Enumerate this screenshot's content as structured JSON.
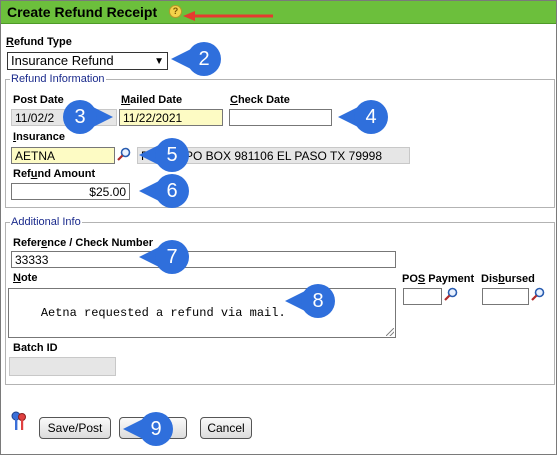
{
  "window": {
    "title": "Create Refund Receipt"
  },
  "refund_type": {
    "label": "Refund Type",
    "value": "Insurance Refund"
  },
  "refund_information": {
    "legend": "Refund Information",
    "post_date": {
      "label": "Post Date",
      "value": "11/02/2"
    },
    "mailed_date": {
      "label": "Mailed Date",
      "value": "11/22/2021"
    },
    "check_date": {
      "label": "Check Date",
      "value": ""
    },
    "insurance": {
      "label": "Insurance",
      "value": "AETNA",
      "address_fragment": "P",
      "address": "PO BOX 981106 EL PASO TX 79998"
    },
    "refund_amount": {
      "label": "Refund Amount",
      "value": "$25.00"
    }
  },
  "additional_info": {
    "legend": "Additional Info",
    "reference": {
      "label": "Reference / Check Number",
      "value": "33333"
    },
    "note": {
      "label": "Note",
      "value": "Aetna requested a refund via mail."
    },
    "pos_payment": {
      "label": "POS Payment",
      "value": ""
    },
    "disbursed": {
      "label": "Disbursed",
      "value": ""
    },
    "batch_id": {
      "label": "Batch ID",
      "value": ""
    }
  },
  "buttons": {
    "save_post": "Save/Post",
    "cancel": "Cancel"
  },
  "callouts": [
    "2",
    "3",
    "4",
    "5",
    "6",
    "7",
    "8",
    "9"
  ],
  "colors": {
    "title_bar": "#6cbf3c",
    "legend_text": "#1a2a8c",
    "callout": "#2f6fdc",
    "highlight_field": "#fdfbc4",
    "arrow": "#e53b2f"
  }
}
